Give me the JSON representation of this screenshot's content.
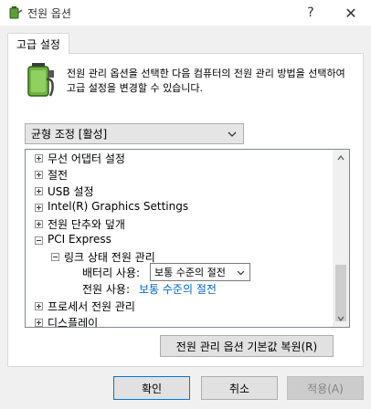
{
  "window": {
    "title": "전원 옵션",
    "help_label": "?",
    "close_label": "✕"
  },
  "tab": {
    "label": "고급 설정"
  },
  "description": "전원 관리 옵션을 선택한 다음 컴퓨터의 전원 관리 방법을 선택하여 고급 설정을 변경할 수 있습니다.",
  "scheme": {
    "selected": "균형 조정 [활성]"
  },
  "tree": {
    "items": [
      {
        "label": "무선 어댑터 설정",
        "expander": "plus"
      },
      {
        "label": "절전",
        "expander": "plus"
      },
      {
        "label": "USB 설정",
        "expander": "plus"
      },
      {
        "label": "Intel(R) Graphics Settings",
        "expander": "plus"
      },
      {
        "label": "전원 단추와 덮개",
        "expander": "plus"
      },
      {
        "label": "PCI Express",
        "expander": "minus"
      },
      {
        "label": "링크 상태 전원 관리",
        "expander": "minus"
      },
      {
        "label": "프로세서 전원 관리",
        "expander": "plus"
      },
      {
        "label": "디스플레이",
        "expander": "plus"
      }
    ],
    "battery_label": "배터리 사용:",
    "battery_value": "보통 수준의 절전",
    "plugged_label": "전원 사용:",
    "plugged_value": "보통 수준의 절전"
  },
  "buttons": {
    "restore": "전원 관리 옵션 기본값 복원(R)",
    "ok": "확인",
    "cancel": "취소",
    "apply": "적용(A)"
  },
  "icons": {
    "title": "power-options-icon",
    "description": "battery-plug-icon"
  },
  "colors": {
    "link": "#0066cc",
    "focus_border": "#0078d7"
  }
}
